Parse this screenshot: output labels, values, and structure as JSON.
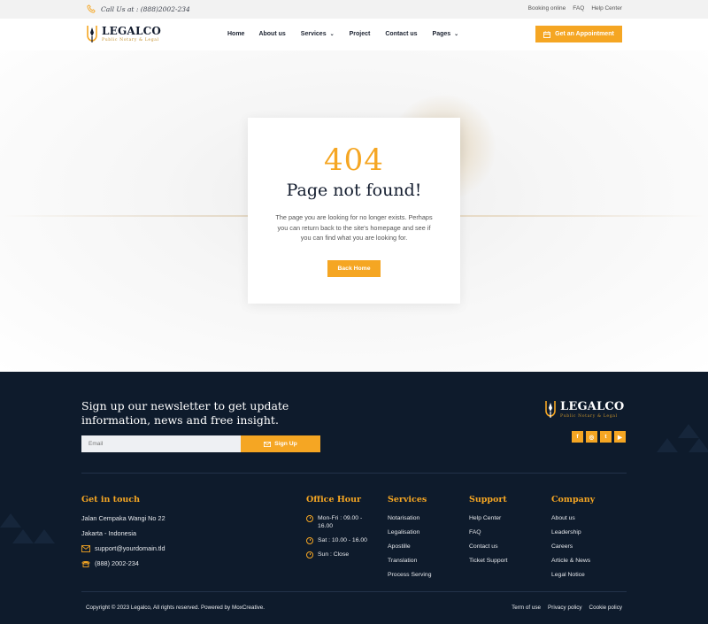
{
  "topbar": {
    "call": "Call Us at : (888)2002-234",
    "links": [
      "Booking online",
      "FAQ",
      "Help Center"
    ]
  },
  "brand": {
    "name": "LEGALCO",
    "tagline": "Public Notary & Legal",
    "accent": "#f5a623",
    "navy": "#0e1b2c"
  },
  "nav": {
    "items": [
      {
        "label": "Home",
        "dropdown": false
      },
      {
        "label": "About us",
        "dropdown": false
      },
      {
        "label": "Services",
        "dropdown": true
      },
      {
        "label": "Project",
        "dropdown": false
      },
      {
        "label": "Contact us",
        "dropdown": false
      },
      {
        "label": "Pages",
        "dropdown": true
      }
    ],
    "cta": "Get an Appointment"
  },
  "error": {
    "code": "404",
    "title": "Page not found!",
    "message": "The page you are looking for no longer exists. Perhaps you can return back to the site's homepage and see if you can find what you are looking for.",
    "button": "Back Home"
  },
  "newsletter": {
    "title": "Sign up our newsletter to get update information, news and free insight.",
    "placeholder": "Email",
    "button": "Sign Up"
  },
  "socials": [
    "f",
    "◎",
    "t",
    "▶"
  ],
  "footer": {
    "contact": {
      "title": "Get in touch",
      "address1": "Jalan Cempaka Wangi No 22",
      "address2": "Jakarta - Indonesia",
      "email": "support@yourdomain.tld",
      "phone": "(888) 2002-234"
    },
    "hours": {
      "title": "Office Hour",
      "items": [
        "Mon-Fri : 09.00 - 16.00",
        "Sat : 10.00 - 16.00",
        "Sun : Close"
      ]
    },
    "services": {
      "title": "Services",
      "items": [
        "Notarisation",
        "Legalisation",
        "Apostille",
        "Translation",
        "Process Serving"
      ]
    },
    "support": {
      "title": "Support",
      "items": [
        "Help Center",
        "FAQ",
        "Contact us",
        "Ticket Support"
      ]
    },
    "company": {
      "title": "Company",
      "items": [
        "About us",
        "Leadership",
        "Careers",
        "Article & News",
        "Legal Notice"
      ]
    },
    "copyright": "Copyright © 2023 Legalco, All rights reserved. Powered by MoxCreative.",
    "legal": [
      "Term of use",
      "Privacy policy",
      "Cookie policy"
    ]
  }
}
